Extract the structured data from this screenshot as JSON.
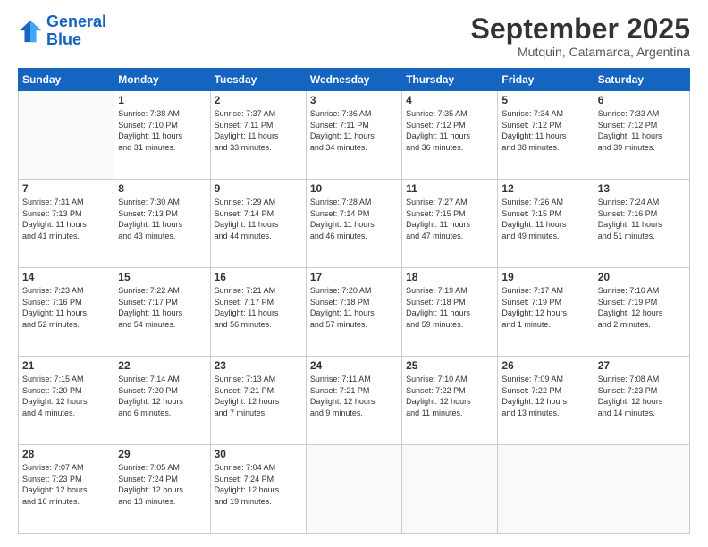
{
  "logo": {
    "line1": "General",
    "line2": "Blue"
  },
  "title": "September 2025",
  "subtitle": "Mutquin, Catamarca, Argentina",
  "days_of_week": [
    "Sunday",
    "Monday",
    "Tuesday",
    "Wednesday",
    "Thursday",
    "Friday",
    "Saturday"
  ],
  "weeks": [
    [
      {
        "day": "",
        "info": ""
      },
      {
        "day": "1",
        "info": "Sunrise: 7:38 AM\nSunset: 7:10 PM\nDaylight: 11 hours\nand 31 minutes."
      },
      {
        "day": "2",
        "info": "Sunrise: 7:37 AM\nSunset: 7:11 PM\nDaylight: 11 hours\nand 33 minutes."
      },
      {
        "day": "3",
        "info": "Sunrise: 7:36 AM\nSunset: 7:11 PM\nDaylight: 11 hours\nand 34 minutes."
      },
      {
        "day": "4",
        "info": "Sunrise: 7:35 AM\nSunset: 7:12 PM\nDaylight: 11 hours\nand 36 minutes."
      },
      {
        "day": "5",
        "info": "Sunrise: 7:34 AM\nSunset: 7:12 PM\nDaylight: 11 hours\nand 38 minutes."
      },
      {
        "day": "6",
        "info": "Sunrise: 7:33 AM\nSunset: 7:12 PM\nDaylight: 11 hours\nand 39 minutes."
      }
    ],
    [
      {
        "day": "7",
        "info": "Sunrise: 7:31 AM\nSunset: 7:13 PM\nDaylight: 11 hours\nand 41 minutes."
      },
      {
        "day": "8",
        "info": "Sunrise: 7:30 AM\nSunset: 7:13 PM\nDaylight: 11 hours\nand 43 minutes."
      },
      {
        "day": "9",
        "info": "Sunrise: 7:29 AM\nSunset: 7:14 PM\nDaylight: 11 hours\nand 44 minutes."
      },
      {
        "day": "10",
        "info": "Sunrise: 7:28 AM\nSunset: 7:14 PM\nDaylight: 11 hours\nand 46 minutes."
      },
      {
        "day": "11",
        "info": "Sunrise: 7:27 AM\nSunset: 7:15 PM\nDaylight: 11 hours\nand 47 minutes."
      },
      {
        "day": "12",
        "info": "Sunrise: 7:26 AM\nSunset: 7:15 PM\nDaylight: 11 hours\nand 49 minutes."
      },
      {
        "day": "13",
        "info": "Sunrise: 7:24 AM\nSunset: 7:16 PM\nDaylight: 11 hours\nand 51 minutes."
      }
    ],
    [
      {
        "day": "14",
        "info": "Sunrise: 7:23 AM\nSunset: 7:16 PM\nDaylight: 11 hours\nand 52 minutes."
      },
      {
        "day": "15",
        "info": "Sunrise: 7:22 AM\nSunset: 7:17 PM\nDaylight: 11 hours\nand 54 minutes."
      },
      {
        "day": "16",
        "info": "Sunrise: 7:21 AM\nSunset: 7:17 PM\nDaylight: 11 hours\nand 56 minutes."
      },
      {
        "day": "17",
        "info": "Sunrise: 7:20 AM\nSunset: 7:18 PM\nDaylight: 11 hours\nand 57 minutes."
      },
      {
        "day": "18",
        "info": "Sunrise: 7:19 AM\nSunset: 7:18 PM\nDaylight: 11 hours\nand 59 minutes."
      },
      {
        "day": "19",
        "info": "Sunrise: 7:17 AM\nSunset: 7:19 PM\nDaylight: 12 hours\nand 1 minute."
      },
      {
        "day": "20",
        "info": "Sunrise: 7:16 AM\nSunset: 7:19 PM\nDaylight: 12 hours\nand 2 minutes."
      }
    ],
    [
      {
        "day": "21",
        "info": "Sunrise: 7:15 AM\nSunset: 7:20 PM\nDaylight: 12 hours\nand 4 minutes."
      },
      {
        "day": "22",
        "info": "Sunrise: 7:14 AM\nSunset: 7:20 PM\nDaylight: 12 hours\nand 6 minutes."
      },
      {
        "day": "23",
        "info": "Sunrise: 7:13 AM\nSunset: 7:21 PM\nDaylight: 12 hours\nand 7 minutes."
      },
      {
        "day": "24",
        "info": "Sunrise: 7:11 AM\nSunset: 7:21 PM\nDaylight: 12 hours\nand 9 minutes."
      },
      {
        "day": "25",
        "info": "Sunrise: 7:10 AM\nSunset: 7:22 PM\nDaylight: 12 hours\nand 11 minutes."
      },
      {
        "day": "26",
        "info": "Sunrise: 7:09 AM\nSunset: 7:22 PM\nDaylight: 12 hours\nand 13 minutes."
      },
      {
        "day": "27",
        "info": "Sunrise: 7:08 AM\nSunset: 7:23 PM\nDaylight: 12 hours\nand 14 minutes."
      }
    ],
    [
      {
        "day": "28",
        "info": "Sunrise: 7:07 AM\nSunset: 7:23 PM\nDaylight: 12 hours\nand 16 minutes."
      },
      {
        "day": "29",
        "info": "Sunrise: 7:05 AM\nSunset: 7:24 PM\nDaylight: 12 hours\nand 18 minutes."
      },
      {
        "day": "30",
        "info": "Sunrise: 7:04 AM\nSunset: 7:24 PM\nDaylight: 12 hours\nand 19 minutes."
      },
      {
        "day": "",
        "info": ""
      },
      {
        "day": "",
        "info": ""
      },
      {
        "day": "",
        "info": ""
      },
      {
        "day": "",
        "info": ""
      }
    ]
  ]
}
